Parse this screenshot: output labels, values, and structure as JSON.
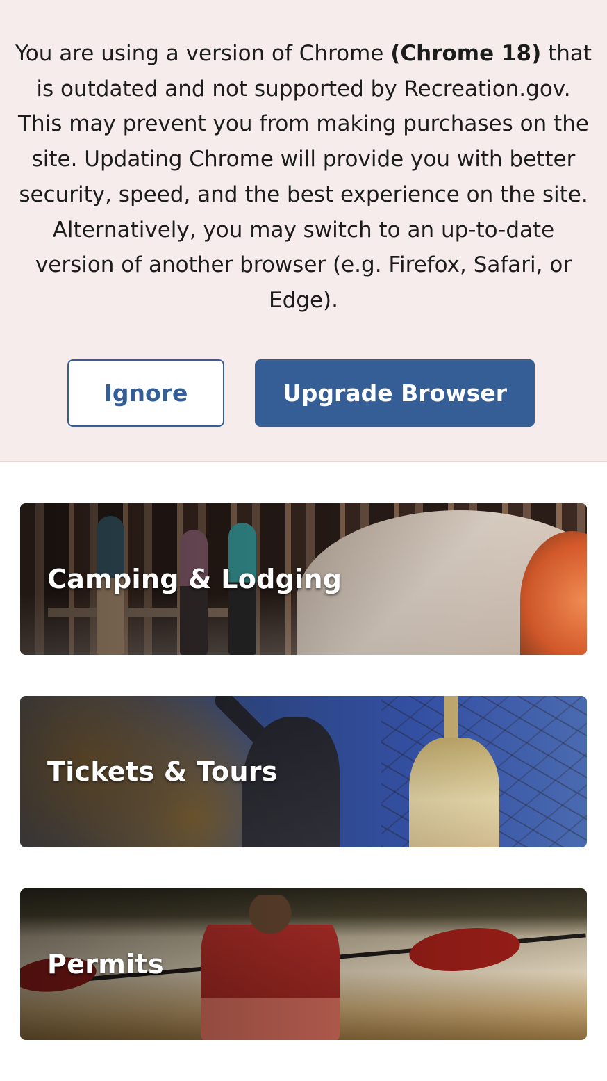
{
  "banner": {
    "message_before": "You are using a version of Chrome ",
    "message_bold": "(Chrome 18)",
    "message_after": " that is outdated and not supported by Recreation.gov. This may prevent you from making purchases on the site. Updating Chrome will provide you with better security, speed, and the best experience on the site. Alternatively, you may switch to an up-to-date version of another browser (e.g. Firefox, Safari, or Edge).",
    "ignore_label": "Ignore",
    "upgrade_label": "Upgrade Browser"
  },
  "cards": [
    {
      "title": "Camping & Lodging"
    },
    {
      "title": "Tickets & Tours"
    },
    {
      "title": "Permits"
    }
  ],
  "colors": {
    "banner_bg": "#f6ecec",
    "primary": "#355e97",
    "text": "#1c1c1c"
  }
}
